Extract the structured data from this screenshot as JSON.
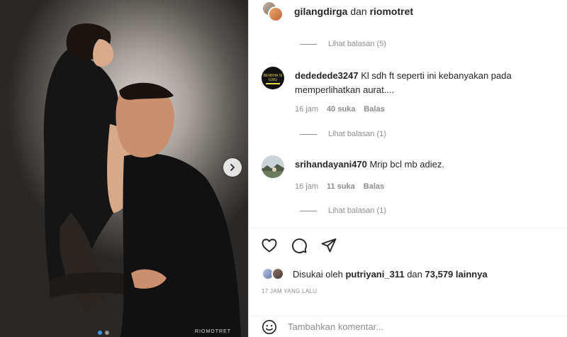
{
  "post": {
    "watermark": "RIOMOTRET",
    "carousel": {
      "slides": 2,
      "active_index": 0
    }
  },
  "header": {
    "user1": "gilangdirga",
    "separator": "dan",
    "user2": "riomotret"
  },
  "comments": [
    {
      "username": "dededede3247",
      "text": "Kl sdh ft seperti ini kebanyakan pada memperlihatkan aurat....",
      "time": "16 jam",
      "likes": "40 suka",
      "reply_label": "Balas",
      "avatar_text": "BENDHA SI ILMU",
      "replies_label": "Lihat balasan (1)"
    },
    {
      "username": "srihandayani470",
      "text": "Mrip bcl mb adiez.",
      "time": "16 jam",
      "likes": "11 suka",
      "reply_label": "Balas",
      "replies_label": "Lihat balasan (1)"
    }
  ],
  "top_replies_label": "Lihat balasan (5)",
  "likes": {
    "prefix": "Disukai oleh",
    "user": "putriyani_311",
    "joiner": "dan",
    "count": "73,579 lainnya"
  },
  "timestamp": "17 JAM YANG LALU",
  "add_comment": {
    "placeholder": "Tambahkan komentar..."
  },
  "icons": {
    "like": "heart-icon",
    "comment": "comment-icon",
    "share": "paper-plane-icon",
    "emoji": "emoji-icon",
    "next": "chevron-right-icon"
  }
}
